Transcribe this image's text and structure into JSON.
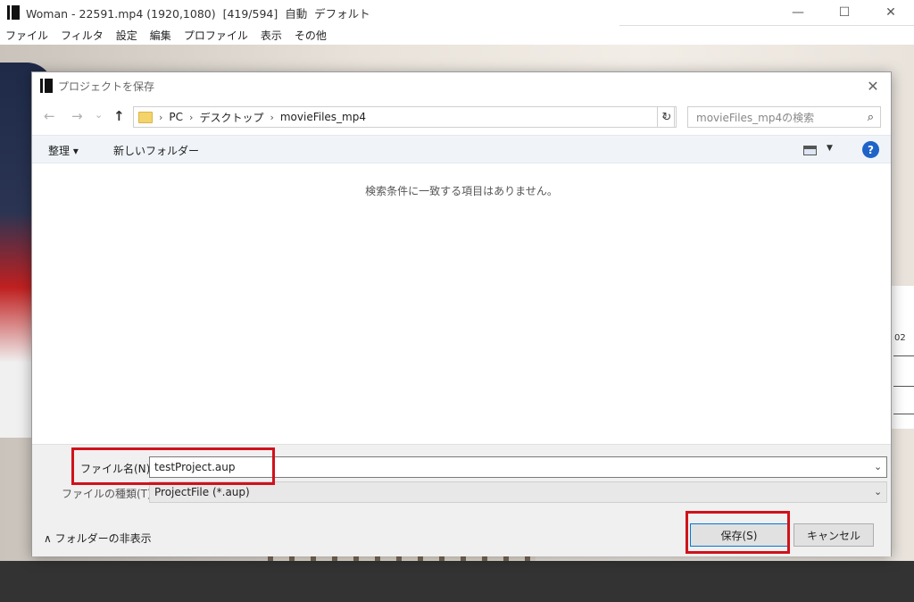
{
  "app": {
    "title": "Woman - 22591.mp4 (1920,1080)  [419/594]  自動  デフォルト",
    "menu": [
      "ファイル",
      "フィルタ",
      "設定",
      "編集",
      "プロファイル",
      "表示",
      "その他"
    ],
    "window_controls": {
      "minimize": "—",
      "maximize": "☐",
      "close": "✕"
    }
  },
  "timeline": {
    "label": "02"
  },
  "dialog": {
    "title": "プロジェクトを保存",
    "close": "✕",
    "nav": {
      "back": "←",
      "forward": "→",
      "recent": "⌄",
      "up": "↑"
    },
    "breadcrumb": [
      "PC",
      "デスクトップ",
      "movieFiles_mp4"
    ],
    "search_placeholder": "movieFiles_mp4の検索",
    "toolbar": {
      "organize": "整理 ▾",
      "new_folder": "新しいフォルダー",
      "help": "?"
    },
    "empty_message": "検索条件に一致する項目はありません。",
    "filename_label": "ファイル名(N):",
    "filename_value": "testProject.aup",
    "filetype_label": "ファイルの種類(T):",
    "filetype_value": "ProjectFile (*.aup)",
    "hide_folders": "フォルダーの非表示",
    "save_button": "保存(S)",
    "cancel_button": "キャンセル"
  },
  "colors": {
    "highlight": "#d0121b",
    "accent": "#0078d7",
    "help": "#1e63c8"
  }
}
